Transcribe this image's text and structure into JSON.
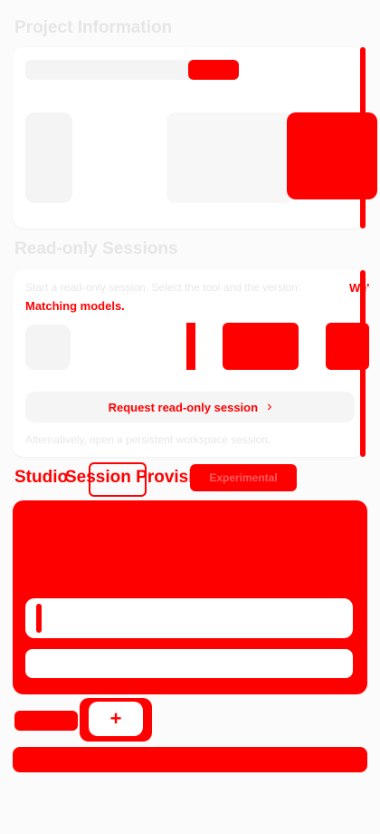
{
  "sections": {
    "project_info": {
      "title": "Project Information"
    },
    "readonly": {
      "title": "Read-only Sessions",
      "intro": "Start a read-only session. Select the tool and the version:",
      "hint_overlay_1": "We'",
      "hint_overlay_2": "Matching models.",
      "request_label": "Request read-only session",
      "alt_text": "Alternatively, open a persistent workspace session."
    },
    "provisioning": {
      "title": "Session Provisioning",
      "overlay_word": "Studio",
      "tag_label": "Experimental"
    }
  },
  "controls": {
    "plus_label": "+",
    "chevron": "›"
  }
}
